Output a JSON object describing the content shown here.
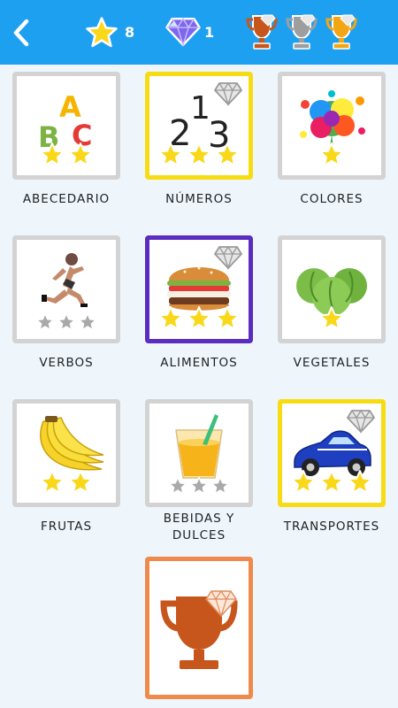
{
  "header": {
    "stars_count": "8",
    "diamonds_count": "1",
    "trophies": [
      "bronze",
      "silver",
      "gold"
    ],
    "colors": {
      "bar": "#1ea0f0",
      "star": "#f9d81a",
      "diamond": "#6a4ee0"
    }
  },
  "categories": [
    {
      "label": "ABECEDARIO",
      "stars": 2,
      "diamond": false,
      "border": "gray"
    },
    {
      "label": "NÚMEROS",
      "stars": 3,
      "diamond": true,
      "border": "gold"
    },
    {
      "label": "COLORES",
      "stars": 1,
      "diamond": false,
      "border": "gray"
    },
    {
      "label": "VERBOS",
      "stars": 0,
      "diamond": false,
      "border": "gray"
    },
    {
      "label": "ALIMENTOS",
      "stars": 3,
      "diamond": true,
      "border": "purple"
    },
    {
      "label": "VEGETALES",
      "stars": 1,
      "diamond": false,
      "border": "gray"
    },
    {
      "label": "FRUTAS",
      "stars": 2,
      "diamond": false,
      "border": "gray"
    },
    {
      "label": "BEBIDAS Y DULCES",
      "stars": 0,
      "diamond": false,
      "border": "gray"
    },
    {
      "label": "TRANSPORTES",
      "stars": 3,
      "diamond": true,
      "border": "gold"
    },
    {
      "label": "",
      "stars": 0,
      "diamond": true,
      "border": "orange",
      "icon": "trophy-icon"
    }
  ],
  "art": {
    "abc_letters": [
      "A",
      "B",
      "C"
    ],
    "number_digits": [
      "2",
      "1",
      "3"
    ]
  }
}
